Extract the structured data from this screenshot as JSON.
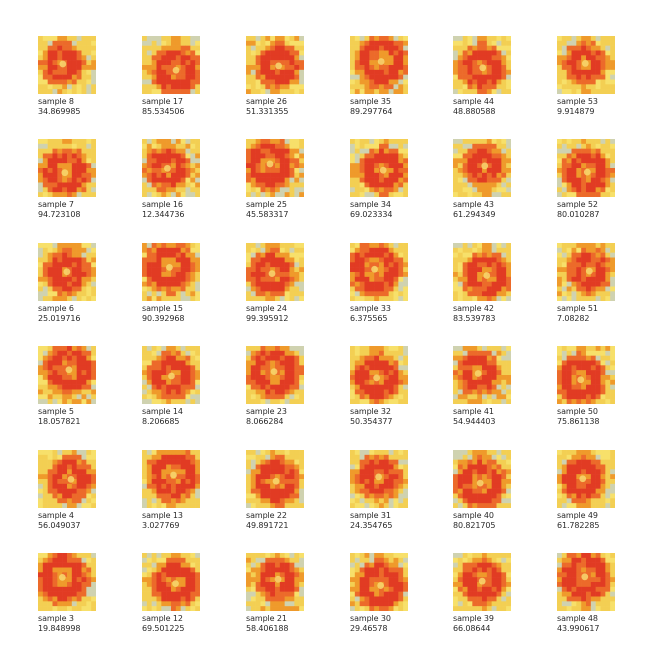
{
  "palette": {
    "background": "#f3cf53",
    "light_yellow": "#f7e06a",
    "grey": "#cfd2b0",
    "orange": "#ef9a2b",
    "orange_red": "#ec6a2a",
    "red": "#e13b23",
    "highlight": "#f7d870"
  },
  "samples": [
    [
      {
        "label": "sample 8",
        "value": "34.869985"
      },
      {
        "label": "sample 17",
        "value": "85.534506"
      },
      {
        "label": "sample 26",
        "value": "51.331355"
      },
      {
        "label": "sample 35",
        "value": "89.297764"
      },
      {
        "label": "sample 44",
        "value": "48.880588"
      },
      {
        "label": "sample 53",
        "value": "9.914879"
      }
    ],
    [
      {
        "label": "sample 7",
        "value": "94.723108"
      },
      {
        "label": "sample 16",
        "value": "12.344736"
      },
      {
        "label": "sample 25",
        "value": "45.583317"
      },
      {
        "label": "sample 34",
        "value": "69.023334"
      },
      {
        "label": "sample 43",
        "value": "61.294349"
      },
      {
        "label": "sample 52",
        "value": "80.010287"
      }
    ],
    [
      {
        "label": "sample 6",
        "value": "25.019716"
      },
      {
        "label": "sample 15",
        "value": "90.392968"
      },
      {
        "label": "sample 24",
        "value": "99.395912"
      },
      {
        "label": "sample 33",
        "value": "6.375565"
      },
      {
        "label": "sample 42",
        "value": "83.539783"
      },
      {
        "label": "sample 51",
        "value": "7.08282"
      }
    ],
    [
      {
        "label": "sample 5",
        "value": "18.057821"
      },
      {
        "label": "sample 14",
        "value": "8.206685"
      },
      {
        "label": "sample 23",
        "value": "8.066284"
      },
      {
        "label": "sample 32",
        "value": "50.354377"
      },
      {
        "label": "sample 41",
        "value": "54.944403"
      },
      {
        "label": "sample 50",
        "value": "75.861138"
      }
    ],
    [
      {
        "label": "sample 4",
        "value": "56.049037"
      },
      {
        "label": "sample 13",
        "value": "3.027769"
      },
      {
        "label": "sample 22",
        "value": "49.891721"
      },
      {
        "label": "sample 31",
        "value": "24.354765"
      },
      {
        "label": "sample 40",
        "value": "80.821705"
      },
      {
        "label": "sample 49",
        "value": "61.782285"
      }
    ],
    [
      {
        "label": "sample 3",
        "value": "19.848998"
      },
      {
        "label": "sample 12",
        "value": "69.501225"
      },
      {
        "label": "sample 21",
        "value": "58.406188"
      },
      {
        "label": "sample 30",
        "value": "29.46578"
      },
      {
        "label": "sample 39",
        "value": "66.08644"
      },
      {
        "label": "sample 48",
        "value": "43.990617"
      }
    ]
  ]
}
